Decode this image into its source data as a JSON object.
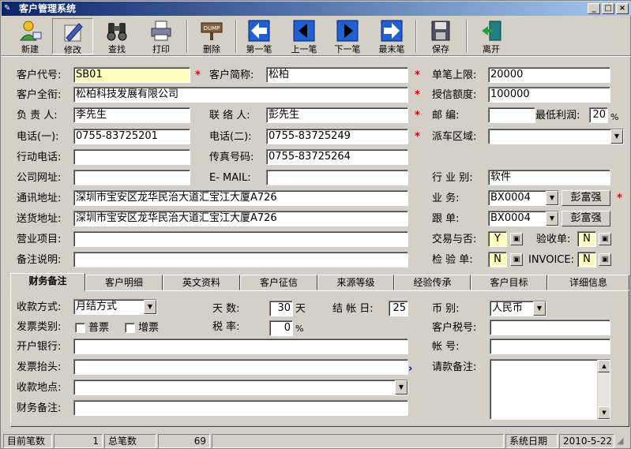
{
  "window": {
    "title": "客户管理系统",
    "min": "_",
    "max": "□",
    "close": "×"
  },
  "toolbar": {
    "new": "新建",
    "edit": "修改",
    "find": "查找",
    "print": "打印",
    "delete": "删除",
    "first": "第一笔",
    "prev": "上一笔",
    "next": "下一笔",
    "last": "最末笔",
    "save": "保存",
    "exit": "离开",
    "dump_text": "DUMP"
  },
  "form": {
    "code_label": "客户代号:",
    "code": "SB01",
    "short_label": "客户简称:",
    "short": "松柏",
    "limit_label": "单笔上限:",
    "limit": "20000",
    "full_label": "客户全衔:",
    "full": "松柏科技发展有限公司",
    "credit_label": "授信额度:",
    "credit": "100000",
    "resp_label": "负 责 人:",
    "resp": "李先生",
    "contact_label": "联 络 人:",
    "contact": "彭先生",
    "postal_label": "邮    编:",
    "postal": "",
    "minprofit_label": "最低利润:",
    "minprofit": "20",
    "pct": "%",
    "tel1_label": "电话(一):",
    "tel1": "0755-83725201",
    "tel2_label": "电话(二):",
    "tel2": "0755-83725249",
    "area_label": "派车区域:",
    "area": "",
    "mobile_label": "行动电话:",
    "mobile": "",
    "fax_label": "传真号码:",
    "fax": "0755-83725264",
    "web_label": "公司网址:",
    "web": "",
    "email_label": "E- MAIL:",
    "email": "",
    "industry_label": "行 业 别:",
    "industry": "软件",
    "addr_label": "通讯地址:",
    "addr": "深圳市宝安区龙华民治大道汇宝江大厦A726",
    "biz_label": "业    务:",
    "biz_code": "BX0004",
    "biz_name": "彭富强",
    "ship_label": "送货地址:",
    "ship": "深圳市宝安区龙华民治大道汇宝江大厦A726",
    "follow_label": "跟    单:",
    "follow_code": "BX0004",
    "follow_name": "彭富强",
    "scope_label": "营业项目:",
    "scope": "",
    "trade_label": "交易与否:",
    "trade": "Y",
    "accept_label": "验收单:",
    "accept": "N",
    "note_label": "备注说明:",
    "note": "",
    "inspect_label": "检 验 单:",
    "inspect": "N",
    "invoice_label": "INVOICE:",
    "invoice": "N"
  },
  "tabs": [
    "财务备注",
    "客户明细",
    "英文资料",
    "客户征信",
    "来源等级",
    "经验传承",
    "客户目标",
    "详细信息"
  ],
  "finance": {
    "pay_label": "收款方式:",
    "pay": "月结方式",
    "days_label": "天      数:",
    "days": "30",
    "days_unit": "天",
    "close_label": "结 帐 日:",
    "close": "25",
    "currency_label": "币    别:",
    "currency": "人民币",
    "invoice_type_label": "发票类别:",
    "opt1": "普票",
    "opt2": "增票",
    "tax_label": "税      率:",
    "tax": "0",
    "tax_pct": "%",
    "taxno_label": "客户税号:",
    "taxno": "",
    "bank_label": "开户银行:",
    "bank": "",
    "account_label": "帐    号:",
    "account": "",
    "title_label": "发票抬头:",
    "title": "",
    "req_label": "请款备注:",
    "req": "",
    "place_label": "收款地点:",
    "place": "",
    "fnote_label": "财务备注:",
    "fnote": ""
  },
  "status": {
    "cur_label": "目前笔数",
    "cur": "1",
    "total_label": "总笔数",
    "total": "69",
    "date_label": "系统日期",
    "date": "2010-5-22"
  }
}
